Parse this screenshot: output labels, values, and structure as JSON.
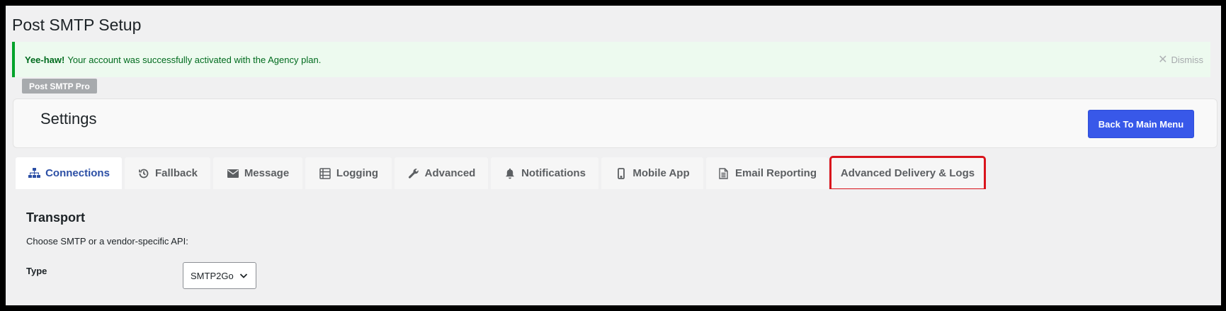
{
  "page": {
    "title": "Post SMTP Setup"
  },
  "notice": {
    "bold": "Yee-haw!",
    "message": "Your account was successfully activated with the Agency plan.",
    "dismiss_label": "Dismiss"
  },
  "badge": {
    "label": "Post SMTP Pro"
  },
  "settings": {
    "title": "Settings",
    "back_button_label": "Back To Main Menu"
  },
  "tabs": [
    {
      "label": "Connections",
      "icon": "sitemap-icon",
      "active": true
    },
    {
      "label": "Fallback",
      "icon": "history-icon"
    },
    {
      "label": "Message",
      "icon": "envelope-icon"
    },
    {
      "label": "Logging",
      "icon": "list-icon"
    },
    {
      "label": "Advanced",
      "icon": "wrench-icon"
    },
    {
      "label": "Notifications",
      "icon": "bell-icon"
    },
    {
      "label": "Mobile App",
      "icon": "mobile-icon"
    },
    {
      "label": "Email Reporting",
      "icon": "document-icon"
    },
    {
      "label": "Advanced Delivery & Logs",
      "icon": "",
      "highlighted": true
    }
  ],
  "transport": {
    "title": "Transport",
    "description": "Choose SMTP or a vendor-specific API:",
    "type_label": "Type",
    "type_value": "SMTP2Go"
  },
  "colors": {
    "accent": "#3858e9",
    "active_tab": "#2c4fa5",
    "success_border": "#00a32a",
    "highlight_box": "#d9141c"
  }
}
